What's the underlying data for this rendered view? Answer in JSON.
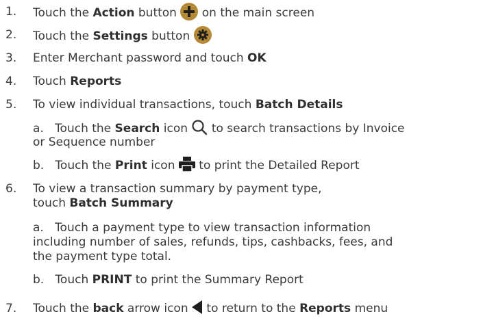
{
  "colors": {
    "text": "#3a3a3a",
    "icon_gold": "#b58a36",
    "icon_dark": "#333333"
  },
  "steps": [
    {
      "num": "1.",
      "pre": "Touch the ",
      "bold": "Action",
      "mid": " button ",
      "icon": "plus-circle-icon",
      "post": " on the main screen"
    },
    {
      "num": "2.",
      "pre": "Touch the ",
      "bold": "Settings",
      "mid": " button ",
      "icon": "gear-circle-icon",
      "post": ""
    },
    {
      "num": "3.",
      "pre": "Enter Merchant password and touch ",
      "bold": "OK",
      "post": ""
    },
    {
      "num": "4.",
      "pre": "Touch ",
      "bold": "Reports",
      "post": ""
    },
    {
      "num": "5.",
      "pre": "To view individual transactions, touch ",
      "bold": "Batch Details",
      "post": ""
    },
    {
      "num": "6.",
      "pre_line1": "To view a transaction summary by payment type,",
      "pre_line2": "touch ",
      "bold": "Batch Summary"
    },
    {
      "num": "7.",
      "pre": "Touch the ",
      "bold": "back",
      "mid": " arrow icon ",
      "icon": "back-arrow-icon",
      "post": " to return to the ",
      "bold2": "Reports",
      "post2": " menu"
    }
  ],
  "sub5": [
    {
      "letter": "a.",
      "pre": "Touch the ",
      "bold": "Search",
      "mid": " icon ",
      "icon": "search-icon",
      "post_line1": " to search transactions by Invoice",
      "post_line2": "or Sequence number"
    },
    {
      "letter": "b.",
      "pre": "Touch the ",
      "bold": "Print",
      "mid": " icon ",
      "icon": "printer-icon",
      "post": " to print the Detailed Report"
    }
  ],
  "sub6": [
    {
      "letter": "a.",
      "text_line1": "Touch a payment type to view transaction information",
      "text_line2": "including number of sales, refunds, tips, cashbacks, fees, and",
      "text_line3": "the payment type total."
    },
    {
      "letter": "b.",
      "pre": "Touch ",
      "bold": "PRINT",
      "post": " to print the Summary Report"
    }
  ]
}
